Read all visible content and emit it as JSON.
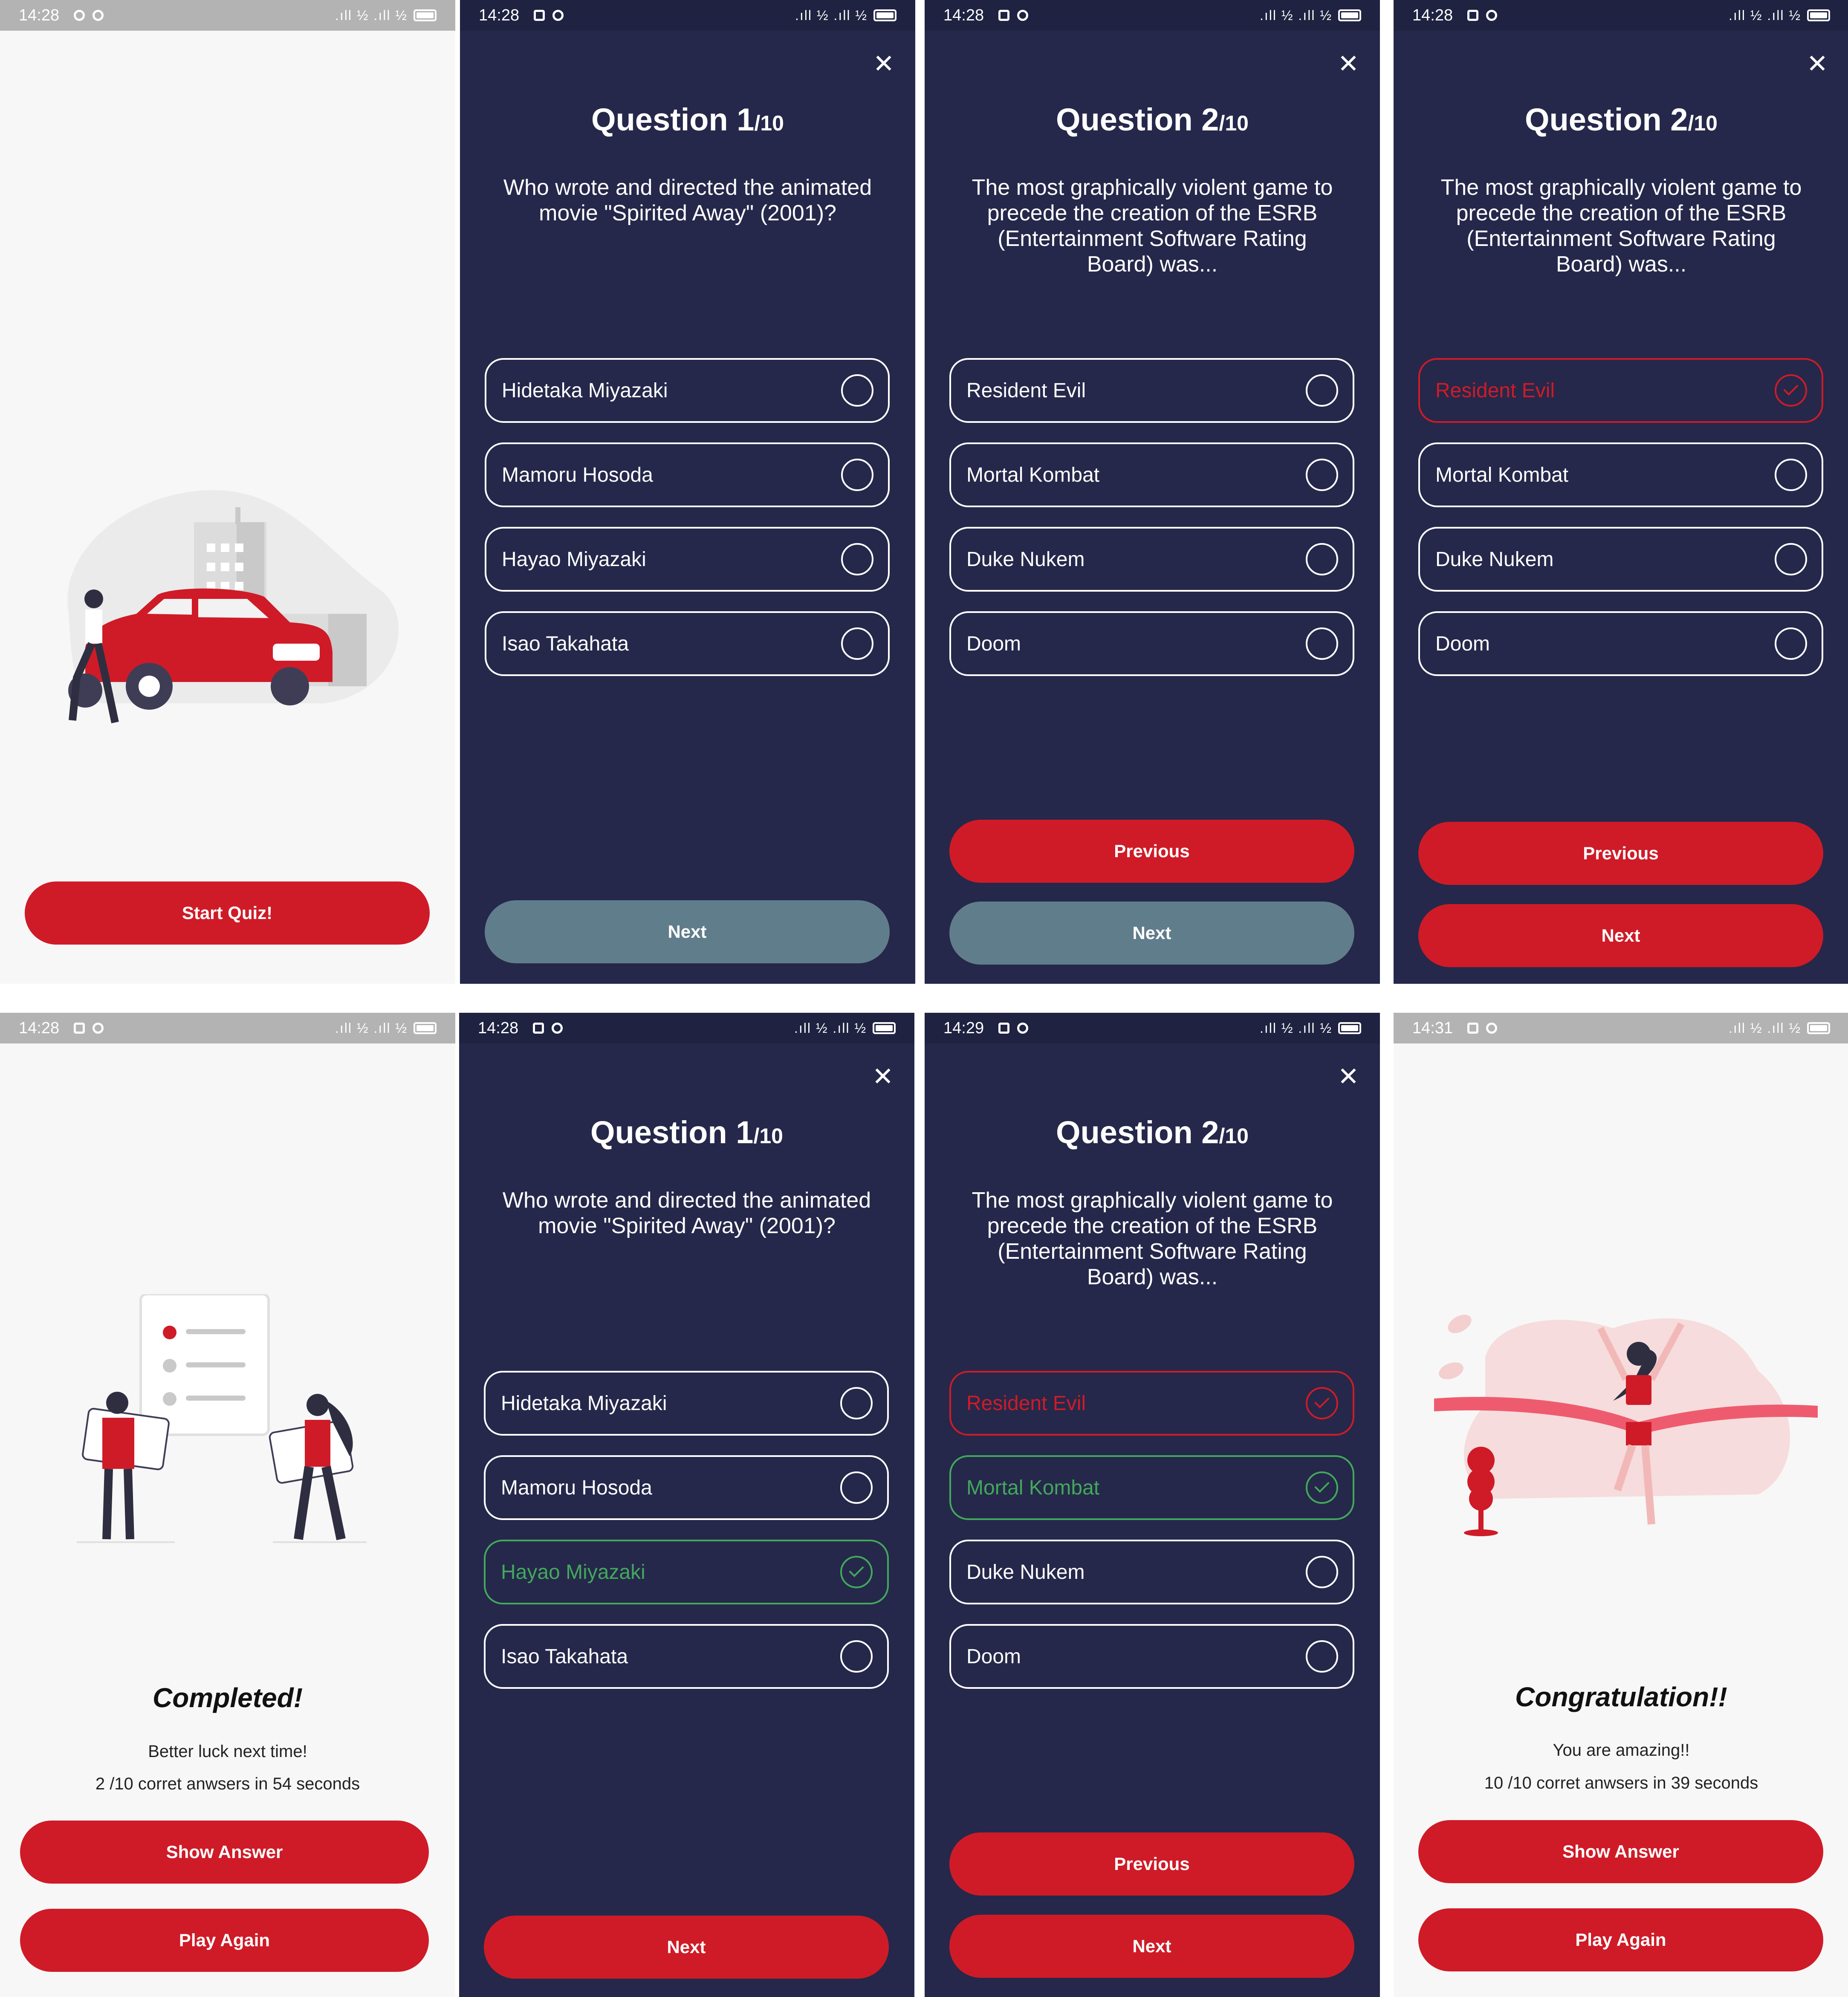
{
  "status_bar": {
    "time_s1": "14:28",
    "time_s2": "14:28",
    "time_s3": "14:28",
    "time_s4": "14:28",
    "time_s5": "14:28",
    "time_s6": "14:28",
    "time_s7": "14:29",
    "time_s8": "14:31",
    "signal_text": ".ıll ½ .ıll ½"
  },
  "icons": {
    "close": "close-icon",
    "radio": "radio-unchecked-icon",
    "check": "check-circle-icon"
  },
  "colors": {
    "dark_bg": "#25284a",
    "accent_red": "#cf1b27",
    "correct_green": "#42a85c",
    "disabled_gray": "#607d8b",
    "light_bg": "#f7f7f7"
  },
  "start": {
    "button": "Start Quiz!"
  },
  "questions": {
    "q1": {
      "number": "Question 1",
      "total": "/10",
      "text": "Who wrote and directed the animated movie \"Spirited Away\" (2001)?",
      "answers": [
        "Hidetaka Miyazaki",
        "Mamoru Hosoda",
        "Hayao Miyazaki",
        "Isao Takahata"
      ]
    },
    "q2": {
      "number": "Question 2",
      "total": "/10",
      "text": "The most graphically violent game to precede the creation of the ESRB (Entertainment Software Rating Board) was...",
      "answers": [
        "Resident Evil",
        "Mortal Kombat",
        "Duke Nukem",
        "Doom"
      ]
    }
  },
  "buttons": {
    "next": "Next",
    "previous": "Previous",
    "show_answer": "Show Answer",
    "play_again": "Play Again"
  },
  "result_fail": {
    "title": "Completed!",
    "subtitle": "Better luck next time!",
    "score": "2 /10 corret anwsers in 54 seconds"
  },
  "result_win": {
    "title": "Congratulation!!",
    "subtitle": "You are amazing!!",
    "score": "10 /10 corret anwsers in 39 seconds"
  }
}
